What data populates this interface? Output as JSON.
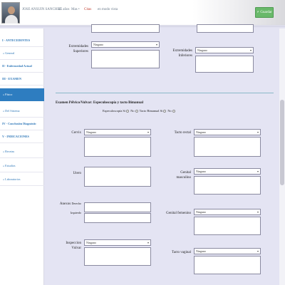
{
  "header": {
    "patient_name": "JOSE ANSUIN SANCHEZ",
    "age": "45 años",
    "sex": "Mas •",
    "appointment": "Citas",
    "mode": "en modo vista",
    "save_label": "⎖ Guardar"
  },
  "sidebar": {
    "items": [
      {
        "label": "I - ANTECEDENTES"
      },
      {
        "label": "» General"
      },
      {
        "label": "II - Enfermedad Actual"
      },
      {
        "label": "III - EXAMEN"
      },
      {
        "label": "» Físico"
      },
      {
        "label": "» Del Sistema"
      },
      {
        "label": "IV - Conclusión Diagnóstic"
      },
      {
        "label": "V - INDICACIONES"
      },
      {
        "label": "» Recetas"
      },
      {
        "label": "» Estudios"
      },
      {
        "label": "» Laboratorios"
      }
    ]
  },
  "extremities": {
    "upper_label": "Extremidades Superiores",
    "upper_value": "Ninguno",
    "lower_label": "Extremidades Inferiores",
    "lower_value": "Ninguno"
  },
  "pelvic": {
    "title": "Examen Pélvico/Vulvar: Especuloscopía y tacto Bimanual",
    "especuloscopia_label": "Especuloscopía",
    "si_label": "Si",
    "no_label": "No",
    "tacto_bimanual_label": "Tacto Bimanual",
    "si2_label": "Si",
    "no2_label": "No",
    "cervix_label": "Cervix",
    "cervix_value": "Ninguno",
    "tacto_rectal_label": "Tacto rectal",
    "tacto_rectal_value": "Ninguno",
    "utero_label": "Utero",
    "genital_masculino_label": "Genital masculino",
    "genital_masculino_value": "Ninguno",
    "anexos_label": "Anexos",
    "anexos_small": "Derecho",
    "anexos_small2": "Izquierdo",
    "genital_femenino_label": "Genital femenino",
    "genital_femenino_value": "Ninguno",
    "inspeccion_label": "Inspeccion Vulvar",
    "inspeccion_value": "Ninguno",
    "tacto_vaginal_label": "Tacto vaginal",
    "tacto_vaginal_value": "Ninguno"
  }
}
